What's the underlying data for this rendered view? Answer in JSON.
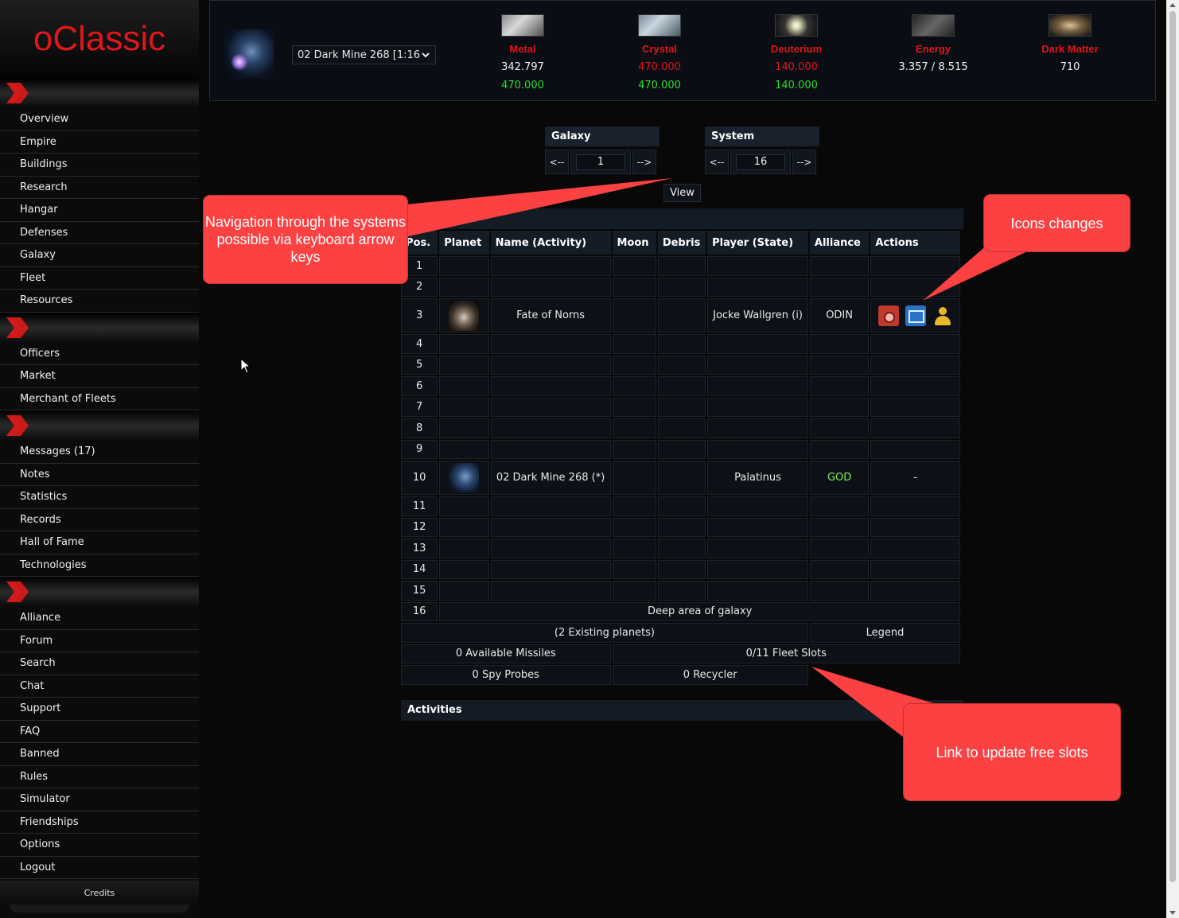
{
  "app": {
    "logo_text": "oClassic"
  },
  "sidebar": {
    "sections": [
      {
        "items": [
          "Overview",
          "Empire",
          "Buildings",
          "Research",
          "Hangar",
          "Defenses",
          "Galaxy",
          "Fleet",
          "Resources"
        ]
      },
      {
        "items": [
          "Officers",
          "Market",
          "Merchant of Fleets"
        ]
      },
      {
        "items": [
          "Messages (17)",
          "Notes",
          "Statistics",
          "Records",
          "Hall of Fame",
          "Technologies"
        ]
      },
      {
        "items": [
          "Alliance",
          "Forum",
          "Search",
          "Chat",
          "Support",
          "FAQ",
          "Banned",
          "Rules",
          "Simulator",
          "Friendships",
          "Options",
          "Logout"
        ]
      }
    ],
    "credits": "Credits"
  },
  "header": {
    "planet_select": "02 Dark Mine 268 [1:16",
    "resources": [
      {
        "name": "Metal",
        "value": "342.797",
        "capacity": "470.000",
        "value_red": false
      },
      {
        "name": "Crystal",
        "value": "470.000",
        "capacity": "470.000",
        "value_red": true
      },
      {
        "name": "Deuterium",
        "value": "140.000",
        "capacity": "140.000",
        "value_red": true
      },
      {
        "name": "Energy",
        "value": "3.357 / 8.515",
        "capacity": "",
        "value_red": false
      },
      {
        "name": "Dark Matter",
        "value": "710",
        "capacity": "",
        "value_red": false
      }
    ]
  },
  "galaxy_nav": {
    "title": "Galaxy",
    "prev": "<--",
    "next": "-->",
    "value": "1"
  },
  "system_nav": {
    "title": "System",
    "prev": "<--",
    "next": "-->",
    "value": "16"
  },
  "view_button": "View",
  "table": {
    "headers": [
      "Pos.",
      "Planet",
      "Name (Activity)",
      "Moon",
      "Debris",
      "Player (State)",
      "Alliance",
      "Actions"
    ],
    "rows": [
      {
        "pos": "1"
      },
      {
        "pos": "2"
      },
      {
        "pos": "3",
        "planet": true,
        "name": "Fate of Norns",
        "player": "Jocke Wallgren (i)",
        "alliance": "ODIN",
        "actions": [
          "camera-icon",
          "mail-icon",
          "buddy-icon"
        ]
      },
      {
        "pos": "4"
      },
      {
        "pos": "5"
      },
      {
        "pos": "6"
      },
      {
        "pos": "7"
      },
      {
        "pos": "8"
      },
      {
        "pos": "9"
      },
      {
        "pos": "10",
        "planet": true,
        "name": "02 Dark Mine 268 (*)",
        "player": "Palatinus",
        "alliance": "GOD",
        "action_text": "-"
      },
      {
        "pos": "11"
      },
      {
        "pos": "12"
      },
      {
        "pos": "13"
      },
      {
        "pos": "14"
      },
      {
        "pos": "15"
      }
    ],
    "deep_row": {
      "pos": "16",
      "text": "Deep area of galaxy"
    },
    "existing_planets": "(2 Existing planets)",
    "legend": "Legend",
    "missiles": "0 Available Missiles",
    "fleet_slots": "0/11 Fleet Slots",
    "spy_probes": "0 Spy Probes",
    "recycler": "0 Recycler"
  },
  "activities_title": "Activities",
  "annotations": {
    "nav_note": "Navigation through the systems possible via keyboard arrow keys",
    "icons_note": "Icons changes",
    "slots_note": "Link to update free slots"
  },
  "colors": {
    "accent_red": "#e0161b",
    "callout": "#fb4142",
    "capacity_green": "#2bdc2b",
    "alliance_god": "#7ff04a"
  }
}
